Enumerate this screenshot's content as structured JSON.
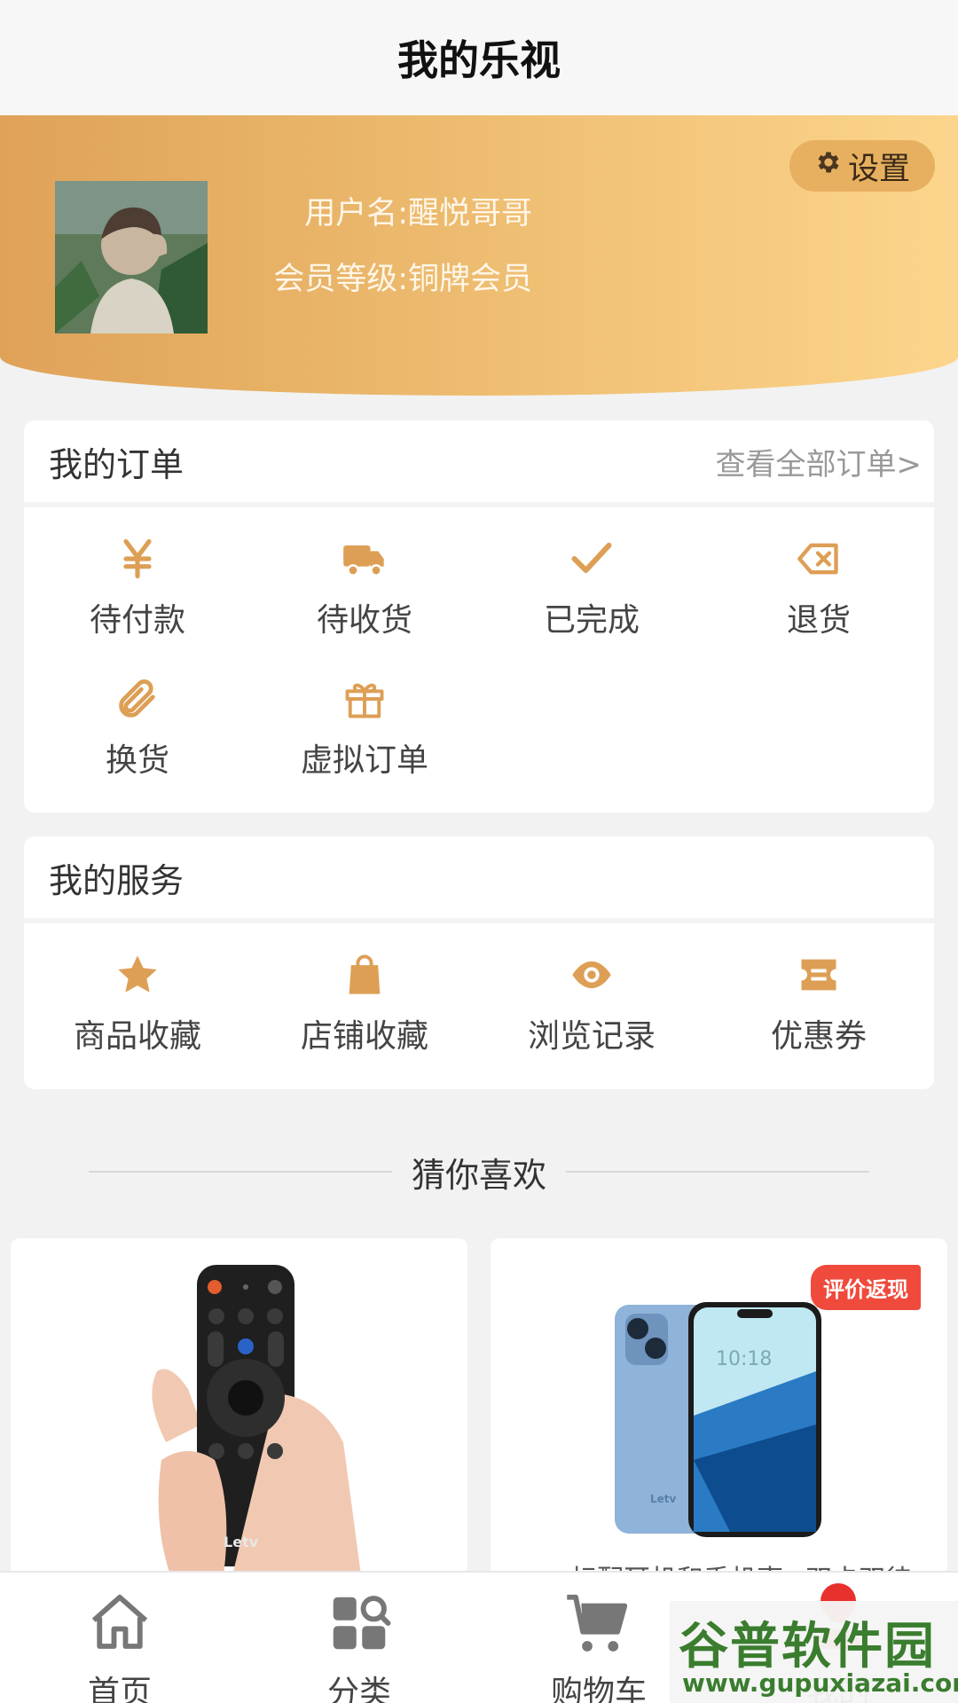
{
  "header": {
    "title": "我的乐视"
  },
  "profile": {
    "username_label": "用户名:",
    "username": "醒悦哥哥",
    "level_label": "会员等级:",
    "level": "铜牌会员",
    "settings_label": "设置"
  },
  "orders": {
    "title": "我的订单",
    "view_all": "查看全部订单>",
    "items": [
      {
        "label": "待付款",
        "icon": "yen-icon"
      },
      {
        "label": "待收货",
        "icon": "truck-icon"
      },
      {
        "label": "已完成",
        "icon": "check-icon"
      },
      {
        "label": "退货",
        "icon": "backspace-x-icon"
      },
      {
        "label": "换货",
        "icon": "paperclip-icon"
      },
      {
        "label": "虚拟订单",
        "icon": "gift-icon"
      }
    ]
  },
  "services": {
    "title": "我的服务",
    "items": [
      {
        "label": "商品收藏",
        "icon": "star-icon"
      },
      {
        "label": "店铺收藏",
        "icon": "bag-icon"
      },
      {
        "label": "浏览记录",
        "icon": "eye-icon"
      },
      {
        "label": "优惠券",
        "icon": "ticket-icon"
      }
    ]
  },
  "recommend": {
    "title": "猜你喜欢",
    "products": [
      {
        "image": "remote-control",
        "badge": "",
        "brand_text": "Letv"
      },
      {
        "image": "smartphone",
        "badge": "评价返现",
        "screen_time": "10:18",
        "brand_text": "Letv",
        "title": "标配耳机和手机壳+双卡双待"
      }
    ]
  },
  "tabbar": {
    "items": [
      {
        "label": "首页",
        "icon": "home-icon"
      },
      {
        "label": "分类",
        "icon": "category-icon"
      },
      {
        "label": "购物车",
        "icon": "cart-icon"
      },
      {
        "label": "我的",
        "icon": "user-icon"
      }
    ]
  },
  "watermark": {
    "line1": "谷普软件园",
    "line2": "www.gupuxiazai.com"
  },
  "colors": {
    "accent": "#dfa258",
    "header_gradient_end": "#fcd58c",
    "badge": "#f04a3c",
    "icon_orange": "#dd9f55",
    "tab_icon": "#777777"
  }
}
